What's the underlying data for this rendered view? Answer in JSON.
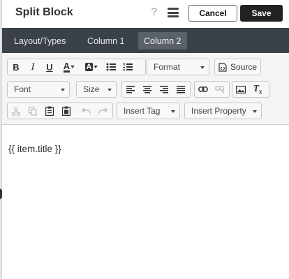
{
  "header": {
    "title": "Split Block",
    "help_symbol": "?",
    "cancel_label": "Cancel",
    "save_label": "Save"
  },
  "tabs": [
    {
      "label": "Layout/Types",
      "active": false
    },
    {
      "label": "Column 1",
      "active": false
    },
    {
      "label": "Column 2",
      "active": true
    }
  ],
  "toolbar": {
    "format_label": "Format",
    "source_label": "Source",
    "font_label": "Font",
    "size_label": "Size",
    "insert_tag_label": "Insert Tag",
    "insert_property_label": "Insert Property",
    "text_color_symbol": "A",
    "bg_color_symbol": "A",
    "bold_symbol": "B",
    "italic_symbol": "I",
    "underline_symbol": "U"
  },
  "editor": {
    "content": "{{ item.title }}"
  },
  "colors": {
    "tabbar": "#3a4149",
    "active_tab": "#5a6169",
    "save_button": "#222222"
  },
  "icons": [
    "help-icon",
    "menu-icon",
    "bold-icon",
    "italic-icon",
    "underline-icon",
    "text-color-icon",
    "background-color-icon",
    "bulleted-list-icon",
    "numbered-list-icon",
    "source-icon",
    "align-left-icon",
    "align-center-icon",
    "align-right-icon",
    "justify-icon",
    "link-icon",
    "unlink-icon",
    "image-icon",
    "remove-format-icon",
    "cut-icon",
    "copy-icon",
    "paste-icon",
    "paste-text-icon",
    "undo-icon",
    "redo-icon"
  ]
}
